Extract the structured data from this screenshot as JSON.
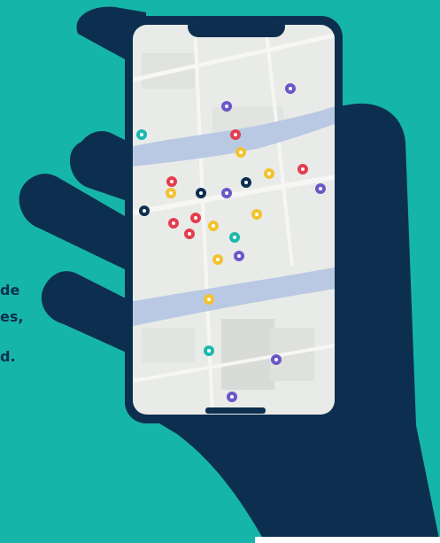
{
  "text_fragments": [
    "de",
    "es,",
    "d."
  ],
  "colors": {
    "background": "#16b5aa",
    "hand": "#0d2f4f",
    "phone_frame": "#0d2f4f",
    "map_base": "#e9ebe8",
    "river": "#b9c9e3",
    "home_indicator": "#0d2f4f"
  },
  "map_markers": [
    {
      "type": "purple",
      "icon": "pin-icon"
    },
    {
      "type": "purple",
      "icon": "pin-icon"
    },
    {
      "type": "teal",
      "icon": "pin-icon"
    },
    {
      "type": "red",
      "icon": "pin-icon"
    },
    {
      "type": "yellow",
      "icon": "pin-icon"
    },
    {
      "type": "red",
      "icon": "pin-icon"
    },
    {
      "type": "purple",
      "icon": "pin-icon"
    },
    {
      "type": "red",
      "icon": "pin-icon"
    },
    {
      "type": "yellow",
      "icon": "pin-icon"
    },
    {
      "type": "navy",
      "icon": "pin-icon"
    },
    {
      "type": "purple",
      "icon": "pin-icon"
    },
    {
      "type": "navy",
      "icon": "pin-icon"
    },
    {
      "type": "navy",
      "icon": "pin-icon"
    },
    {
      "type": "yellow",
      "icon": "pin-icon"
    },
    {
      "type": "red",
      "icon": "pin-icon"
    },
    {
      "type": "red",
      "icon": "pin-icon"
    },
    {
      "type": "yellow",
      "icon": "pin-icon"
    },
    {
      "type": "red",
      "icon": "pin-icon"
    },
    {
      "type": "yellow",
      "icon": "pin-icon"
    },
    {
      "type": "teal",
      "icon": "pin-icon"
    },
    {
      "type": "yellow",
      "icon": "pin-icon"
    },
    {
      "type": "purple",
      "icon": "pin-icon"
    },
    {
      "type": "yellow",
      "icon": "pin-icon"
    },
    {
      "type": "teal",
      "icon": "pin-icon"
    },
    {
      "type": "purple",
      "icon": "pin-icon"
    },
    {
      "type": "purple",
      "icon": "pin-icon"
    }
  ]
}
